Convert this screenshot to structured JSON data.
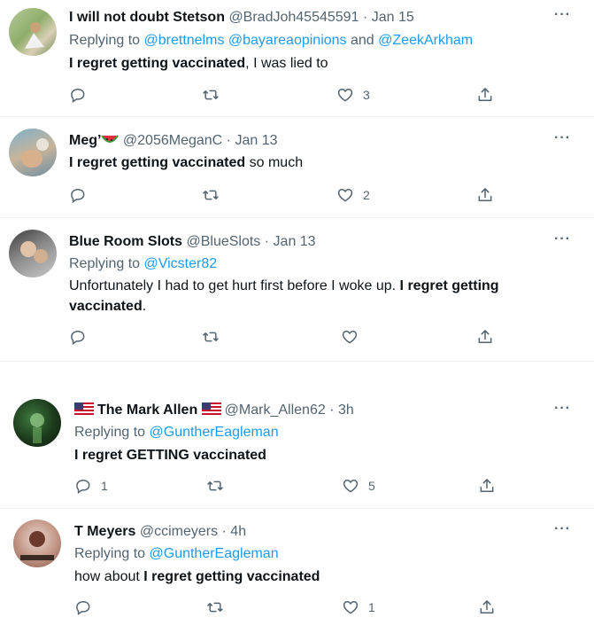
{
  "tweets": [
    {
      "name": "I will not doubt Stetson",
      "handle": "@BradJoh45545591",
      "date": "· Jan 15",
      "replying_prefix": "Replying to",
      "replying_to": "@brettnelms @bayareaopinions",
      "replying_and": "and",
      "replying_to_2": "@ZeekArkham",
      "text_bold": "I regret getting vaccinated",
      "text_rest": ", I was lied to",
      "replies": "",
      "likes": "3",
      "more": "···"
    },
    {
      "name": "Meg’",
      "handle": "@2056MeganC",
      "date": "· Jan 13",
      "text_bold": "I regret getting vaccinated",
      "text_rest": " so much",
      "replies": "",
      "likes": "2",
      "more": "···"
    },
    {
      "name": "Blue Room Slots",
      "handle": "@BlueSlots",
      "date": "· Jan 13",
      "replying_prefix": "Replying to",
      "replying_to": "@Vicster82",
      "text_pre": "Unfortunately I had to get hurt first before I woke up. ",
      "text_bold": "I regret getting vaccinated",
      "text_rest": ".",
      "replies": "",
      "likes": "",
      "more": "···"
    },
    {
      "name": "The Mark Allen",
      "handle": "@Mark_Allen62",
      "date": "· 3h",
      "replying_prefix": "Replying to",
      "replying_to": "@GuntherEagleman",
      "text_bold": "I regret GETTING vaccinated",
      "replies": "1",
      "likes": "5",
      "more": "···"
    },
    {
      "name": "T Meyers",
      "handle": "@ccimeyers",
      "date": "· 4h",
      "replying_prefix": "Replying to",
      "replying_to": "@GuntherEagleman",
      "text_pre": "how about ",
      "text_bold": "I regret getting vaccinated",
      "replies": "",
      "likes": "1",
      "more": "···"
    }
  ],
  "icons": {
    "reply": "reply-icon",
    "retweet": "retweet-icon",
    "like": "heart-icon",
    "share": "share-icon",
    "more": "more-icon"
  },
  "colors": {
    "link": "#1d9bf0",
    "secondary": "#536471",
    "text": "#0f1419"
  }
}
